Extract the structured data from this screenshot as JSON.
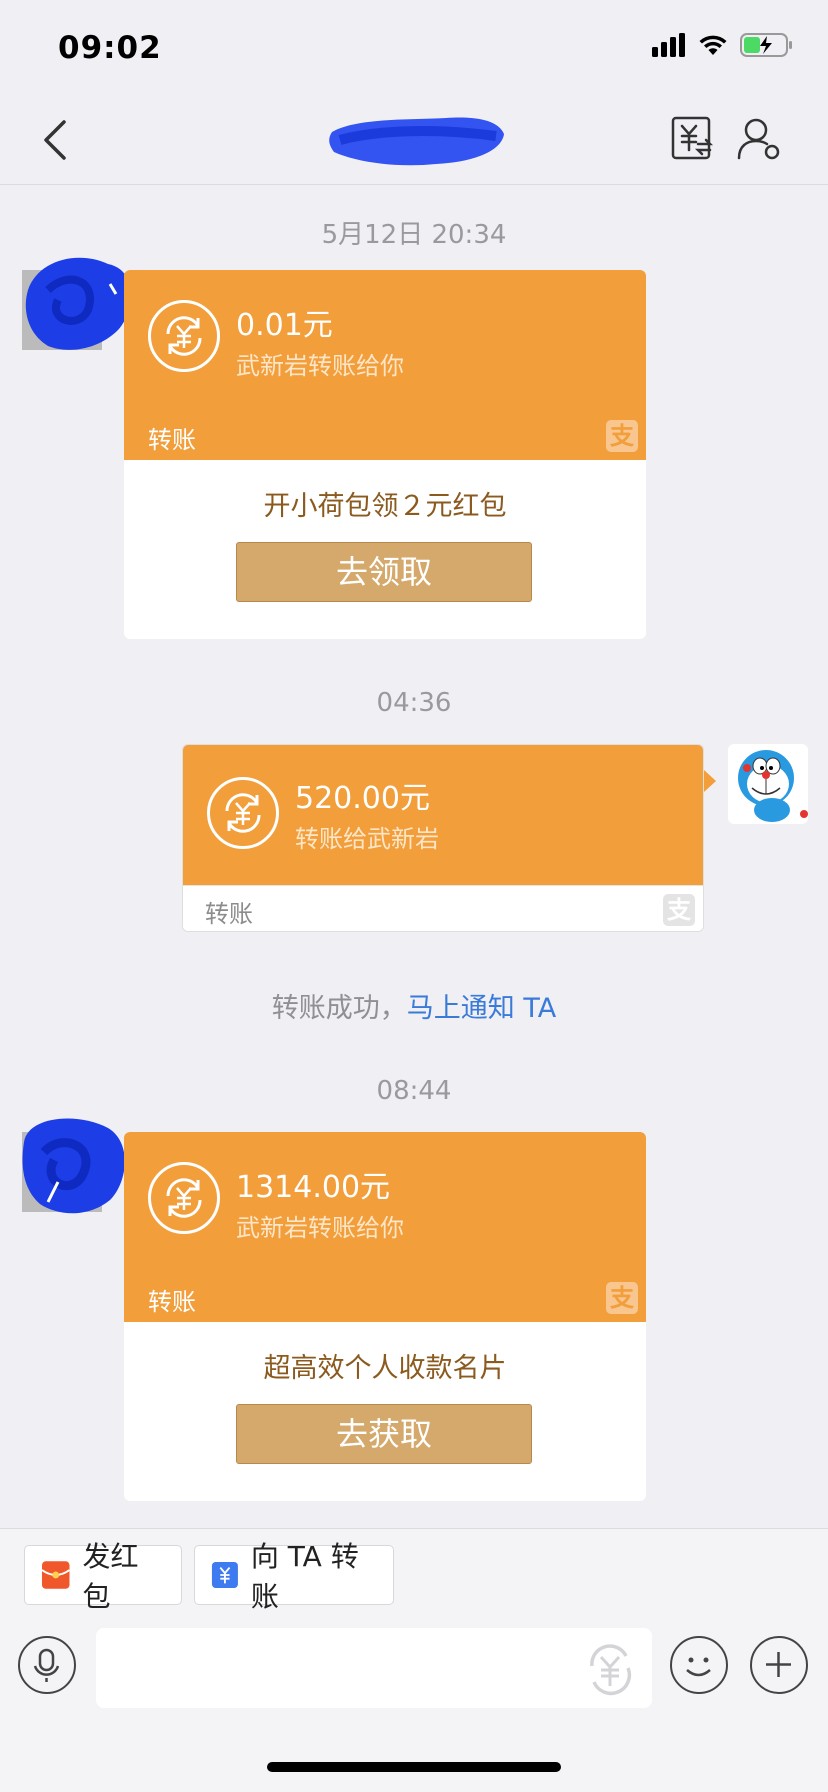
{
  "status_bar": {
    "time": "09:02"
  },
  "nav": {
    "title": ""
  },
  "messages": [
    {
      "timestamp": "5月12日 20:34",
      "amount": "0.01元",
      "subtext": "武新岩转账给你",
      "label": "转账",
      "promo_text": "开小荷包领２元红包",
      "promo_button": "去领取"
    },
    {
      "timestamp": "04:36",
      "amount": "520.00元",
      "subtext": "转账给武新岩",
      "label": "转账"
    },
    {
      "timestamp": "08:44",
      "amount": "1314.00元",
      "subtext": "武新岩转账给你",
      "label": "转账",
      "promo_text": "超高效个人收款名片",
      "promo_button": "去获取"
    }
  ],
  "system_message": {
    "text": "转账成功，",
    "link": "马上通知 TA"
  },
  "quick_actions": {
    "red_packet": "发红包",
    "transfer": "向 TA 转账"
  },
  "input": {
    "placeholder": ""
  },
  "pay_logo_glyph": "支",
  "colors": {
    "orange": "#f29e3b",
    "link": "#3a7ad9",
    "button": "#d5a96b"
  }
}
